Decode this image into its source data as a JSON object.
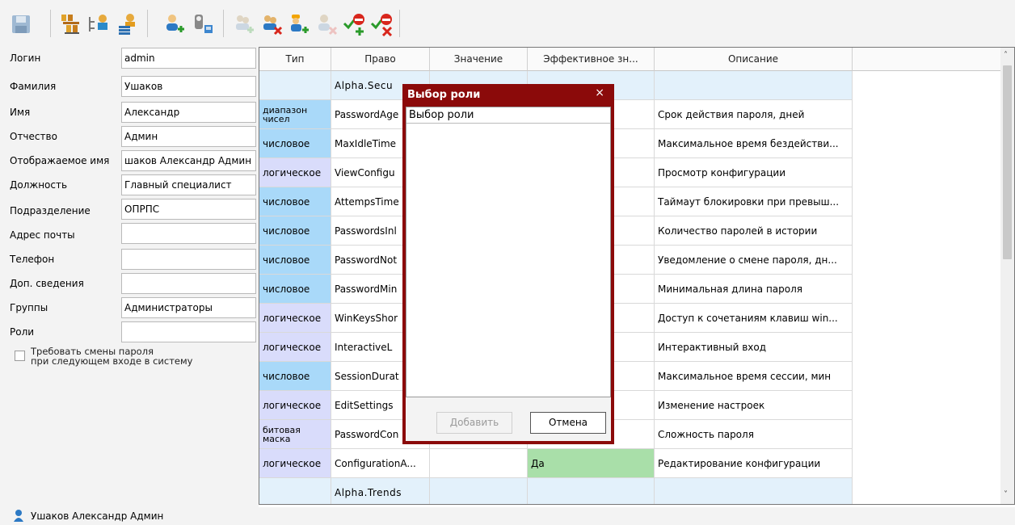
{
  "toolbar": {
    "icons": [
      "save-icon",
      "user-tree-icon",
      "user-tree-alt-icon",
      "users-list-icon",
      "add-user-icon",
      "user-keys-icon",
      "add-group-icon",
      "remove-group-icon",
      "add-worker-icon",
      "remove-user-icon",
      "add-right-icon",
      "remove-right-icon"
    ]
  },
  "form": {
    "fields": [
      {
        "label": "Логин",
        "value": "admin"
      },
      {
        "label": "Фамилия",
        "value": "Ушаков"
      },
      {
        "label": "Имя",
        "value": "Александр"
      },
      {
        "label": "Отчество",
        "value": "Админ"
      },
      {
        "label": "Отображаемое имя",
        "value": "шаков Александр Админ"
      },
      {
        "label": "Должность",
        "value": "Главный специалист"
      },
      {
        "label": "Подразделение",
        "value": "ОПРПС"
      },
      {
        "label": "Адрес почты",
        "value": ""
      },
      {
        "label": "Телефон",
        "value": ""
      },
      {
        "label": "Доп. сведения",
        "value": ""
      },
      {
        "label": "Группы",
        "value": "Администраторы"
      },
      {
        "label": "Роли",
        "value": ""
      }
    ],
    "checkbox_line1": "Требовать смены пароля",
    "checkbox_line2": "при следующем входе в систему"
  },
  "table": {
    "headers": [
      "Тип",
      "Право",
      "Значение",
      "Эффективное зн...",
      "Описание"
    ],
    "rows": [
      {
        "type": "",
        "right": "Alpha.Secu",
        "value": "",
        "effective": "",
        "desc": ""
      },
      {
        "type": "диапазон\nчисел",
        "right": "PasswordAge",
        "value": "",
        "effective": "",
        "desc": "Срок действия пароля, дней"
      },
      {
        "type": "числовое",
        "right": "MaxIdleTime",
        "value": "",
        "effective": "",
        "desc": "Максимальное время бездействи..."
      },
      {
        "type": "логическое",
        "right": "ViewConfigu",
        "value": "",
        "effective": "",
        "desc": "Просмотр конфигурации"
      },
      {
        "type": "числовое",
        "right": "AttempsTime",
        "value": "",
        "effective": "",
        "desc": "Таймаут блокировки при превыш..."
      },
      {
        "type": "числовое",
        "right": "PasswordsInl",
        "value": "",
        "effective": "",
        "desc": "Количество паролей в истории"
      },
      {
        "type": "числовое",
        "right": "PasswordNot",
        "value": "",
        "effective": "",
        "desc": "Уведомление о смене пароля, дн..."
      },
      {
        "type": "числовое",
        "right": "PasswordMin",
        "value": "",
        "effective": "",
        "desc": "Минимальная длина пароля"
      },
      {
        "type": "логическое",
        "right": "WinKeysShor",
        "value": "",
        "effective": "",
        "desc": "Доступ к сочетаниям клавиш win..."
      },
      {
        "type": "логическое",
        "right": "InteractiveL",
        "value": "",
        "effective": "",
        "desc": "Интерактивный вход"
      },
      {
        "type": "числовое",
        "right": "SessionDurat",
        "value": "",
        "effective": "",
        "desc": "Максимальное время сессии, мин"
      },
      {
        "type": "логическое",
        "right": "EditSettings",
        "value": "",
        "effective": "",
        "desc": "Изменение настроек"
      },
      {
        "type": "битовая\nмаска",
        "right": "PasswordCon",
        "value": "",
        "effective": "",
        "desc": "Сложность пароля"
      },
      {
        "type": "логическое",
        "right": "ConfigurationA...",
        "value": "",
        "effective": "Да",
        "desc": "Редактирование конфигурации"
      },
      {
        "type": "",
        "right": "Alpha.Trends",
        "value": "",
        "effective": "",
        "desc": ""
      }
    ]
  },
  "dialog": {
    "title": "Выбор роли",
    "close": "×",
    "list_header": "Выбор роли",
    "add_label": "Добавить",
    "cancel_label": "Отмена"
  },
  "status": {
    "user": "Ушаков Александр Админ"
  },
  "colors": {
    "group_row": "#e3f1fb",
    "type_numeric": "#a9d9f9",
    "type_logical": "#d9dcfb",
    "effective_true": "#a9dfa9",
    "dialog_frame": "#8b0a0a"
  }
}
